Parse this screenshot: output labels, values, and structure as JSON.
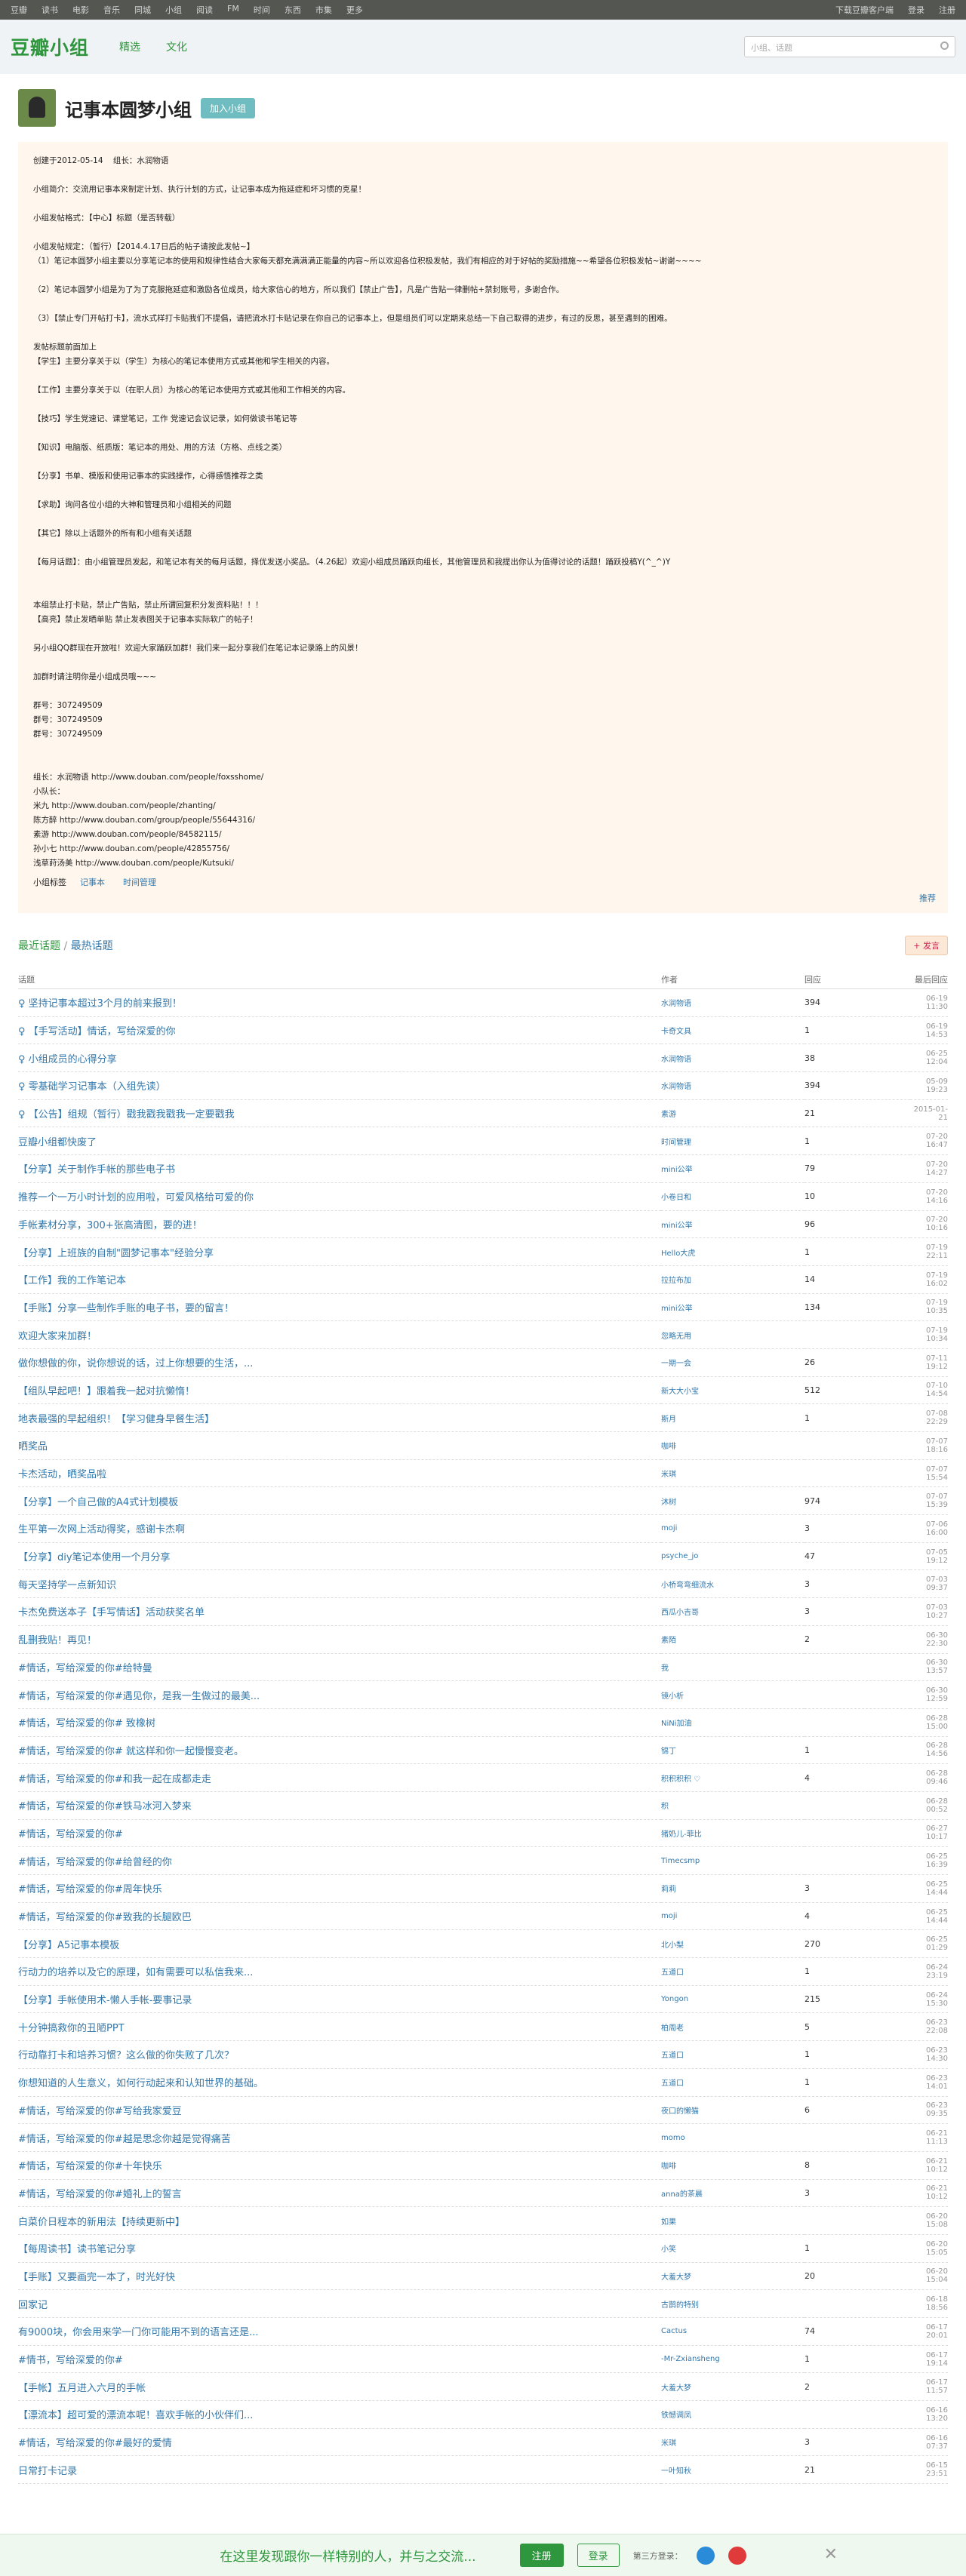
{
  "topbar": {
    "left": [
      "豆瓣",
      "读书",
      "电影",
      "音乐",
      "同城",
      "小组",
      "阅读",
      "FM",
      "时间",
      "东西",
      "市集",
      "更多"
    ],
    "right": [
      "下载豆瓣客户端",
      "登录",
      "注册"
    ]
  },
  "header": {
    "logo": "豆瓣小组",
    "nav": [
      "精选",
      "文化"
    ],
    "search_placeholder": "小组、话题"
  },
  "group": {
    "name": "记事本圆梦小组",
    "join": "加入小组",
    "intro": "创建于2012-05-14    组长：水润物语\n\n小组简介：交流用记事本来制定计划、执行计划的方式，让记事本成为拖延症和坏习惯的克星！\n\n小组发帖格式：【中心】标题（是否转载）\n\n小组发帖规定：（暂行）【2014.4.17日后的帖子请按此发帖~】\n（1）笔记本圆梦小组主要以分享笔记本的使用和规律性结合大家每天都充满满满正能量的内容~所以欢迎各位积极发帖，我们有相应的对于好帖的奖励措施~~希望各位积极发帖~谢谢~~~~\n\n（2）笔记本圆梦小组是为了为了克服拖延症和激励各位成员，给大家信心的地方，所以我们【禁止广告】，凡是广告贴一律删帖+禁封账号，多谢合作。\n\n（3）【禁止专门开帖打卡】，流水式样打卡贴我们不提倡，请把流水打卡贴记录在你自己的记事本上，但是组员们可以定期来总结一下自己取得的进步，有过的反思，甚至遇到的困难。\n\n发帖标题前面加上\n【学生】主要分享关于以（学生）为核心的笔记本使用方式或其他和学生相关的内容。\n\n【工作】主要分享关于以（在职人员）为核心的笔记本使用方式或其他和工作相关的内容。\n\n【技巧】学生党速记、课堂笔记，工作 党速记会议记录，如何做读书笔记等\n\n【知识】电脑版、纸质版：笔记本的用处、用的方法（方格、点线之类）\n\n【分享】书单、模版和使用记事本的实践操作，心得感悟推荐之类\n\n【求助】询问各位小组的大神和管理员和小组相关的问题\n\n【其它】除以上话题外的所有和小组有关话题\n\n【每月话题】：由小组管理员发起，和笔记本有关的每月话题，择优发送小奖品。（4.26起）欢迎小组成员踊跃向组长，其他管理员和我提出你认为值得讨论的话题！踊跃投稿Y(^_^)Y\n\n\n本组禁止打卡贴，禁止广告贴，禁止所谓回复积分发资料贴！！！\n【高亮】禁止发晒单贴 禁止发表图关于记事本实际软广的帖子！\n\n另小组QQ群现在开放啦！欢迎大家踊跃加群！我们来一起分享我们在笔记本记录路上的风景！\n\n加群时请注明你是小组成员哦~~~\n\n群号：307249509\n群号：307249509\n群号：307249509\n\n\n组长：水润物语 http://www.douban.com/people/foxsshome/\n小队长：\n米九 http://www.douban.com/people/zhanting/\n陈方醉 http://www.douban.com/group/people/55644316/\n素游 http://www.douban.com/people/84582115/\n孙小七 http://www.douban.com/people/42855756/\n浅草莳汤美 http://www.douban.com/people/Kutsuki/",
    "tags_label": "小组标签",
    "tags": [
      "记事本",
      "时间管理"
    ],
    "recommend": "推荐"
  },
  "tabs": {
    "latest": "最近话题",
    "sep": " / ",
    "newest": "最热话题",
    "post": "+ 发言"
  },
  "table": {
    "headers": [
      "话题",
      "作者",
      "回应",
      "最后回应"
    ],
    "rows": [
      [
        "♀ 坚持记事本超过3个月的前来报到！",
        "水润物语",
        "394",
        "06-19 11:30"
      ],
      [
        "♀ 【手写活动】情话，写给深爱的你",
        "卡奇文具",
        "1",
        "06-19 14:53"
      ],
      [
        "♀ 小组成员的心得分享",
        "水润物语",
        "38",
        "06-25 12:04"
      ],
      [
        "♀ 零基础学习记事本（入组先读）",
        "水润物语",
        "394",
        "05-09 19:23"
      ],
      [
        "♀ 【公告】组规（暂行）戳我戳我戳我一定要戳我",
        "素游",
        "21",
        "2015-01-21"
      ],
      [
        "豆瓣小组都快废了",
        "时间管理",
        "1",
        "07-20 16:47"
      ],
      [
        "【分享】关于制作手帐的那些电子书",
        "mini公举",
        "79",
        "07-20 14:27"
      ],
      [
        "推荐一个一万小时计划的应用啦，可爱风格给可爱的你",
        "小卷日和",
        "10",
        "07-20 14:16"
      ],
      [
        "手帐素材分享，300+张高清图，要的进！",
        "mini公举",
        "96",
        "07-20 10:16"
      ],
      [
        "【分享】上班族的自制\"圆梦记事本\"经验分享",
        "Hello大虎",
        "1",
        "07-19 22:11"
      ],
      [
        "【工作】我的工作笔记本",
        "拉拉布加",
        "14",
        "07-19 16:02"
      ],
      [
        "【手账】分享一些制作手账的电子书，要的留言！",
        "mini公举",
        "134",
        "07-19 10:35"
      ],
      [
        "欢迎大家来加群！",
        "忽略无用",
        "",
        "07-19 10:34"
      ],
      [
        "做你想做的你，说你想说的话，过上你想要的生活，...",
        "一期一会",
        "26",
        "07-11 19:12"
      ],
      [
        "【组队早起吧！】跟着我一起对抗懒惰！",
        "新大大小宝",
        "512",
        "07-10 14:54"
      ],
      [
        "地表最强的早起组织！【学习健身早餐生活】",
        "斯月",
        "1",
        "07-08 22:29"
      ],
      [
        "晒奖品",
        "咖啡",
        "",
        "07-07 18:16"
      ],
      [
        "卡杰活动，晒奖品啦",
        "米琪",
        "",
        "07-07 15:54"
      ],
      [
        "【分享】一个自己做的A4式计划模板",
        "沐树",
        "974",
        "07-07 15:39"
      ],
      [
        "生平第一次网上活动得奖，感谢卡杰啊",
        "moji",
        "3",
        "07-06 16:00"
      ],
      [
        "【分享】diy笔记本使用一个月分享",
        "psyche_jo",
        "47",
        "07-05 19:12"
      ],
      [
        "每天坚持学一点新知识",
        "小桥弯弯细流水",
        "3",
        "07-03 09:37"
      ],
      [
        "卡杰免费送本子【手写情话】活动获奖名单",
        "西瓜小吉哥",
        "3",
        "07-03 10:27"
      ],
      [
        "乱删我贴！再见！",
        "素陌",
        "2",
        "06-30 22:30"
      ],
      [
        "#情话，写给深爱的你#给特曼",
        "我",
        "",
        "06-30 13:57"
      ],
      [
        "#情话，写给深爱的你#遇见你，是我一生做过的最美...",
        "镜小析",
        "",
        "06-30 12:59"
      ],
      [
        "#情话，写给深爱的你# 致橡树",
        "NiNi加油",
        "",
        "06-28 15:00"
      ],
      [
        "#情话，写给深爱的你# 就这样和你一起慢慢变老。",
        "锦丁",
        "1",
        "06-28 14:56"
      ],
      [
        "#情话，写给深爱的你#和我一起在成都走走",
        "积积积积 ♡",
        "4",
        "06-28 09:46"
      ],
      [
        "#情话，写给深爱的你#铁马冰河入梦来",
        "积",
        "",
        "06-28 00:52"
      ],
      [
        "#情话，写给深爱的你#",
        "猪奶儿-菲比",
        "",
        "06-27 10:17"
      ],
      [
        "#情话，写给深爱的你#给曾经的你",
        "Timecsmp",
        "",
        "06-25 16:39"
      ],
      [
        "#情话，写给深爱的你#周年快乐",
        "莉莉",
        "3",
        "06-25 14:44"
      ],
      [
        "#情话，写给深爱的你#致我的长腿欧巴",
        "moji",
        "4",
        "06-25 14:44"
      ],
      [
        "【分享】A5记事本模板",
        "北小梨",
        "270",
        "06-25 01:29"
      ],
      [
        "行动力的培养以及它的原理，如有需要可以私信我来...",
        "五道口",
        "1",
        "06-24 23:19"
      ],
      [
        "【分享】手帐使用术-懒人手帐-要事记录",
        "Yongon",
        "215",
        "06-24 15:30"
      ],
      [
        "十分钟搞救你的丑陋PPT",
        "柏周老",
        "5",
        "06-23 22:08"
      ],
      [
        "行动靠打卡和培养习惯？这么做的你失败了几次？",
        "五道口",
        "1",
        "06-23 14:30"
      ],
      [
        "你想知道的人生意义，如何行动起来和认知世界的基础。",
        "五道口",
        "1",
        "06-23 14:01"
      ],
      [
        "#情话，写给深爱的你#写给我家爱豆",
        "夜口的懒猫",
        "6",
        "06-23 09:35"
      ],
      [
        "#情话，写给深爱的你#越是思念你越是觉得痛苦",
        "momo",
        "",
        "06-21 11:13"
      ],
      [
        "#情话，写给深爱的你#十年快乐",
        "咖啡",
        "8",
        "06-21 10:12"
      ],
      [
        "#情话，写给深爱的你#婚礼上的誓言",
        "anna的茶晨",
        "3",
        "06-21 10:12"
      ],
      [
        "白菜价日程本的新用法【持续更新中】",
        "如果",
        "",
        "06-20 15:08"
      ],
      [
        "【每周读书】读书笔记分享",
        "小笑",
        "1",
        "06-20 15:05"
      ],
      [
        "【手账】又要画完一本了，时光好快",
        "大羞大梦",
        "20",
        "06-20 15:04"
      ],
      [
        "回家记",
        "古鹊的特别",
        "",
        "06-18 18:56"
      ],
      [
        "有9000块，你会用来学一门你可能用不到的语言还是...",
        "Cactus",
        "74",
        "06-17 20:01"
      ],
      [
        "#情书，写给深爱的你#",
        "-Mr-Zxiansheng",
        "1",
        "06-17 19:14"
      ],
      [
        "【手帐】五月进入六月的手帐",
        "大羞大梦",
        "2",
        "06-17 11:57"
      ],
      [
        "【漂流本】超可爱的漂流本呢！喜欢手帐的小伙伴们...",
        "铁憾调凤",
        "",
        "06-16 13:20"
      ],
      [
        "#情话，写给深爱的你#最好的爱情",
        "米琪",
        "3",
        "06-16 07:37"
      ],
      [
        "日常打卡记录",
        "一叶知秋",
        "21",
        "06-15 23:51"
      ]
    ]
  },
  "bottom": {
    "msg": "在这里发现跟你一样特别的人，并与之交流...",
    "register": "注册",
    "login": "登录",
    "third": "第三方登录："
  }
}
